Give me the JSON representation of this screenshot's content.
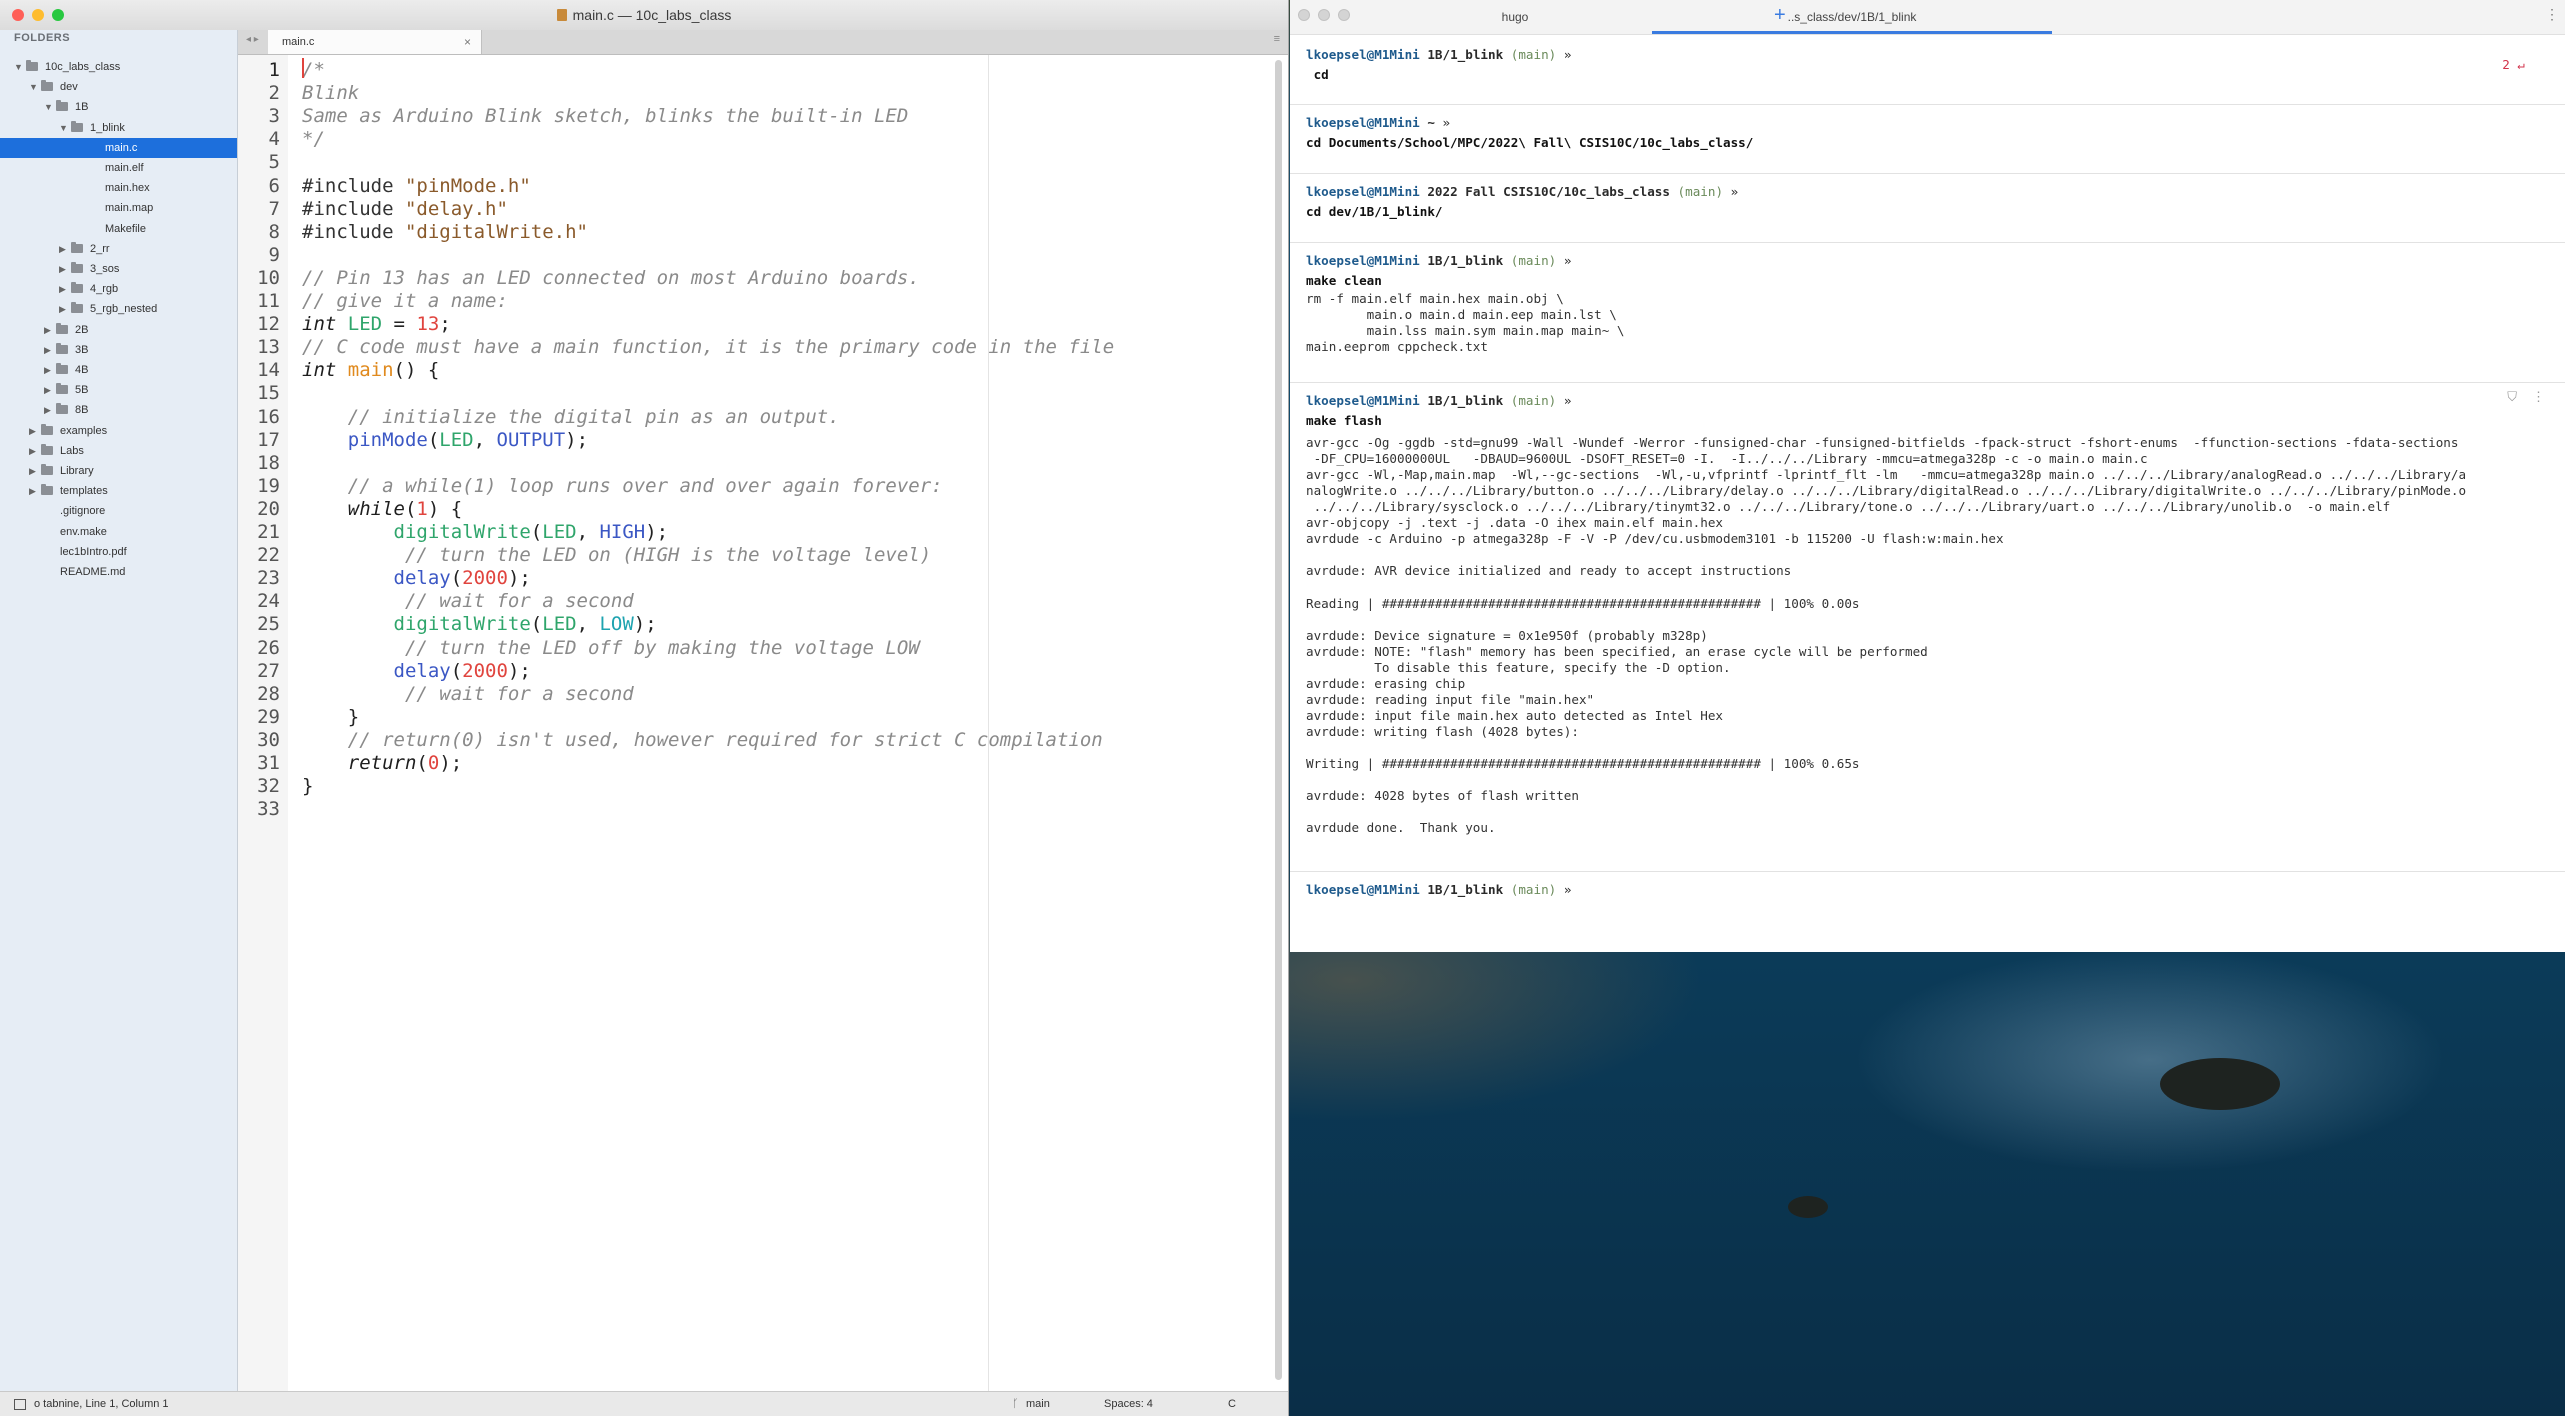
{
  "editor": {
    "title": "main.c — 10c_labs_class",
    "sidebar_header": "FOLDERS",
    "tree": [
      {
        "label": "10c_labs_class",
        "depth": 0,
        "expanded": true,
        "type": "folder"
      },
      {
        "label": "dev",
        "depth": 1,
        "expanded": true,
        "type": "folder"
      },
      {
        "label": "1B",
        "depth": 2,
        "expanded": true,
        "type": "folder"
      },
      {
        "label": "1_blink",
        "depth": 3,
        "expanded": true,
        "type": "folder"
      },
      {
        "label": "main.c",
        "depth": 4,
        "type": "file",
        "selected": true
      },
      {
        "label": "main.elf",
        "depth": 4,
        "type": "file"
      },
      {
        "label": "main.hex",
        "depth": 4,
        "type": "file"
      },
      {
        "label": "main.map",
        "depth": 4,
        "type": "file"
      },
      {
        "label": "Makefile",
        "depth": 4,
        "type": "file"
      },
      {
        "label": "2_rr",
        "depth": 3,
        "expanded": false,
        "type": "folder"
      },
      {
        "label": "3_sos",
        "depth": 3,
        "expanded": false,
        "type": "folder"
      },
      {
        "label": "4_rgb",
        "depth": 3,
        "expanded": false,
        "type": "folder"
      },
      {
        "label": "5_rgb_nested",
        "depth": 3,
        "expanded": false,
        "type": "folder"
      },
      {
        "label": "2B",
        "depth": 2,
        "expanded": false,
        "type": "folder"
      },
      {
        "label": "3B",
        "depth": 2,
        "expanded": false,
        "type": "folder"
      },
      {
        "label": "4B",
        "depth": 2,
        "expanded": false,
        "type": "folder"
      },
      {
        "label": "5B",
        "depth": 2,
        "expanded": false,
        "type": "folder"
      },
      {
        "label": "8B",
        "depth": 2,
        "expanded": false,
        "type": "folder"
      },
      {
        "label": "examples",
        "depth": 1,
        "expanded": false,
        "type": "folder"
      },
      {
        "label": "Labs",
        "depth": 1,
        "expanded": false,
        "type": "folder"
      },
      {
        "label": "Library",
        "depth": 1,
        "expanded": false,
        "type": "folder"
      },
      {
        "label": "templates",
        "depth": 1,
        "expanded": false,
        "type": "folder"
      },
      {
        "label": ".gitignore",
        "depth": 1,
        "type": "file"
      },
      {
        "label": "env.make",
        "depth": 1,
        "type": "file"
      },
      {
        "label": "lec1bIntro.pdf",
        "depth": 1,
        "type": "file"
      },
      {
        "label": "README.md",
        "depth": 1,
        "type": "file"
      }
    ],
    "tab": {
      "label": "main.c",
      "close": "×"
    },
    "tab_nav": "◂ ▸",
    "tab_menu": "≡",
    "code": [
      [
        [
          "c",
          "/*"
        ]
      ],
      [
        [
          "c",
          "Blink"
        ]
      ],
      [
        [
          "c",
          "Same as Arduino Blink sketch, blinks the built-in LED"
        ]
      ],
      [
        [
          "c",
          "*/"
        ]
      ],
      [],
      [
        [
          "pp",
          "#include "
        ],
        [
          "str",
          "\"pinMode.h\""
        ]
      ],
      [
        [
          "pp",
          "#include "
        ],
        [
          "str",
          "\"delay.h\""
        ]
      ],
      [
        [
          "pp",
          "#include "
        ],
        [
          "str",
          "\"digitalWrite.h\""
        ]
      ],
      [],
      [
        [
          "c",
          "// Pin 13 has an LED connected on most Arduino boards."
        ]
      ],
      [
        [
          "c",
          "// give it a name:"
        ]
      ],
      [
        [
          "kw",
          "int"
        ],
        [
          "p",
          " "
        ],
        [
          "id",
          "LED"
        ],
        [
          "p",
          " = "
        ],
        [
          "num",
          "13"
        ],
        [
          "p",
          ";"
        ]
      ],
      [
        [
          "c",
          "// C code must have a main function, it is the primary code in the file"
        ]
      ],
      [
        [
          "kw",
          "int"
        ],
        [
          "p",
          " "
        ],
        [
          "mainfn",
          "main"
        ],
        [
          "p",
          "() {"
        ]
      ],
      [],
      [
        [
          "p",
          "    "
        ],
        [
          "c",
          "// initialize the digital pin as an output."
        ]
      ],
      [
        [
          "p",
          "    "
        ],
        [
          "fn",
          "pinMode"
        ],
        [
          "p",
          "("
        ],
        [
          "id",
          "LED"
        ],
        [
          "p",
          ", "
        ],
        [
          "fn",
          "OUTPUT"
        ],
        [
          "p",
          ");"
        ]
      ],
      [],
      [
        [
          "p",
          "    "
        ],
        [
          "c",
          "// a while(1) loop runs over and over again forever:"
        ]
      ],
      [
        [
          "p",
          "    "
        ],
        [
          "kw",
          "while"
        ],
        [
          "p",
          "("
        ],
        [
          "num",
          "1"
        ],
        [
          "p",
          ") {"
        ]
      ],
      [
        [
          "p",
          "        "
        ],
        [
          "fn2",
          "digitalWrite"
        ],
        [
          "p",
          "("
        ],
        [
          "id",
          "LED"
        ],
        [
          "p",
          ", "
        ],
        [
          "fn",
          "HIGH"
        ],
        [
          "p",
          ");"
        ]
      ],
      [
        [
          "p",
          "         "
        ],
        [
          "c",
          "// turn the LED on (HIGH is the voltage level)"
        ]
      ],
      [
        [
          "p",
          "        "
        ],
        [
          "fn",
          "delay"
        ],
        [
          "p",
          "("
        ],
        [
          "num",
          "2000"
        ],
        [
          "p",
          ");"
        ]
      ],
      [
        [
          "p",
          "         "
        ],
        [
          "c",
          "// wait for a second"
        ]
      ],
      [
        [
          "p",
          "        "
        ],
        [
          "fn2",
          "digitalWrite"
        ],
        [
          "p",
          "("
        ],
        [
          "id",
          "LED"
        ],
        [
          "p",
          ", "
        ],
        [
          "const",
          "LOW"
        ],
        [
          "p",
          ");"
        ]
      ],
      [
        [
          "p",
          "         "
        ],
        [
          "c",
          "// turn the LED off by making the voltage LOW"
        ]
      ],
      [
        [
          "p",
          "        "
        ],
        [
          "fn",
          "delay"
        ],
        [
          "p",
          "("
        ],
        [
          "num",
          "2000"
        ],
        [
          "p",
          ");"
        ]
      ],
      [
        [
          "p",
          "         "
        ],
        [
          "c",
          "// wait for a second"
        ]
      ],
      [
        [
          "p",
          "    }"
        ]
      ],
      [
        [
          "p",
          "    "
        ],
        [
          "c",
          "// return(0) isn't used, however required for strict C compilation"
        ]
      ],
      [
        [
          "p",
          "    "
        ],
        [
          "kw",
          "return"
        ],
        [
          "p",
          "("
        ],
        [
          "num",
          "0"
        ],
        [
          "p",
          ");"
        ]
      ],
      [
        [
          "p",
          "}"
        ]
      ],
      []
    ],
    "status": {
      "left": "o tabnine, Line 1, Column 1",
      "branch": "main",
      "spaces": "Spaces: 4",
      "syntax": "C"
    }
  },
  "terminal": {
    "tabs": [
      {
        "label": "hugo",
        "active": false
      },
      {
        "label": "..s_class/dev/1B/1_blink",
        "active": true
      }
    ],
    "plus": "+",
    "menu": "⋮",
    "blocks": [
      {
        "prompt": {
          "user": "lkoepsel@M1Mini",
          "dir": "1B/1_blink",
          "branch": "(main)",
          "sym": "»"
        },
        "command": " cd",
        "exit_code": "2 ↵",
        "output": []
      },
      {
        "prompt": {
          "user": "lkoepsel@M1Mini",
          "dir": "~",
          "branch": "",
          "sym": "»"
        },
        "command": "cd Documents/School/MPC/2022\\ Fall\\ CSIS10C/10c_labs_class/",
        "output": []
      },
      {
        "prompt": {
          "user": "lkoepsel@M1Mini",
          "dir": "2022 Fall CSIS10C/10c_labs_class",
          "branch": "(main)",
          "sym": "»"
        },
        "command": "cd dev/1B/1_blink/",
        "output": []
      },
      {
        "prompt": {
          "user": "lkoepsel@M1Mini",
          "dir": "1B/1_blink",
          "branch": "(main)",
          "sym": "»"
        },
        "command": "make clean",
        "output": [
          "rm -f main.elf main.hex main.obj \\",
          "        main.o main.d main.eep main.lst \\",
          "        main.lss main.sym main.map main~ \\",
          "main.eeprom cppcheck.txt"
        ]
      },
      {
        "prompt": {
          "user": "lkoepsel@M1Mini",
          "dir": "1B/1_blink",
          "branch": "(main)",
          "sym": "»"
        },
        "command": "make flash",
        "output": [
          "avr-gcc -Og -ggdb -std=gnu99 -Wall -Wundef -Werror -funsigned-char -funsigned-bitfields -fpack-struct -fshort-enums  -ffunction-sections -fdata-sections",
          " -DF_CPU=16000000UL   -DBAUD=9600UL -DSOFT_RESET=0 -I.  -I../../../Library -mmcu=atmega328p -c -o main.o main.c",
          "avr-gcc -Wl,-Map,main.map  -Wl,--gc-sections  -Wl,-u,vfprintf -lprintf_flt -lm   -mmcu=atmega328p main.o ../../../Library/analogRead.o ../../../Library/a",
          "nalogWrite.o ../../../Library/button.o ../../../Library/delay.o ../../../Library/digitalRead.o ../../../Library/digitalWrite.o ../../../Library/pinMode.o",
          " ../../../Library/sysclock.o ../../../Library/tinymt32.o ../../../Library/tone.o ../../../Library/uart.o ../../../Library/unolib.o  -o main.elf",
          "avr-objcopy -j .text -j .data -O ihex main.elf main.hex",
          "avrdude -c Arduino -p atmega328p -F -V -P /dev/cu.usbmodem3101 -b 115200 -U flash:w:main.hex",
          "",
          "avrdude: AVR device initialized and ready to accept instructions",
          "",
          "Reading | ################################################## | 100% 0.00s",
          "",
          "avrdude: Device signature = 0x1e950f (probably m328p)",
          "avrdude: NOTE: \"flash\" memory has been specified, an erase cycle will be performed",
          "         To disable this feature, specify the -D option.",
          "avrdude: erasing chip",
          "avrdude: reading input file \"main.hex\"",
          "avrdude: input file main.hex auto detected as Intel Hex",
          "avrdude: writing flash (4028 bytes):",
          "",
          "Writing | ################################################## | 100% 0.65s",
          "",
          "avrdude: 4028 bytes of flash written",
          "",
          "avrdude done.  Thank you.",
          ""
        ]
      },
      {
        "prompt": {
          "user": "lkoepsel@M1Mini",
          "dir": "1B/1_blink",
          "branch": "(main)",
          "sym": "»"
        },
        "command": "",
        "output": []
      }
    ]
  },
  "colors": {
    "selection": "#1d6fdc",
    "traffic_close": "#ff5f57",
    "traffic_min": "#febc2e",
    "traffic_max": "#28c840",
    "terminal_accent": "#3a7be0"
  }
}
